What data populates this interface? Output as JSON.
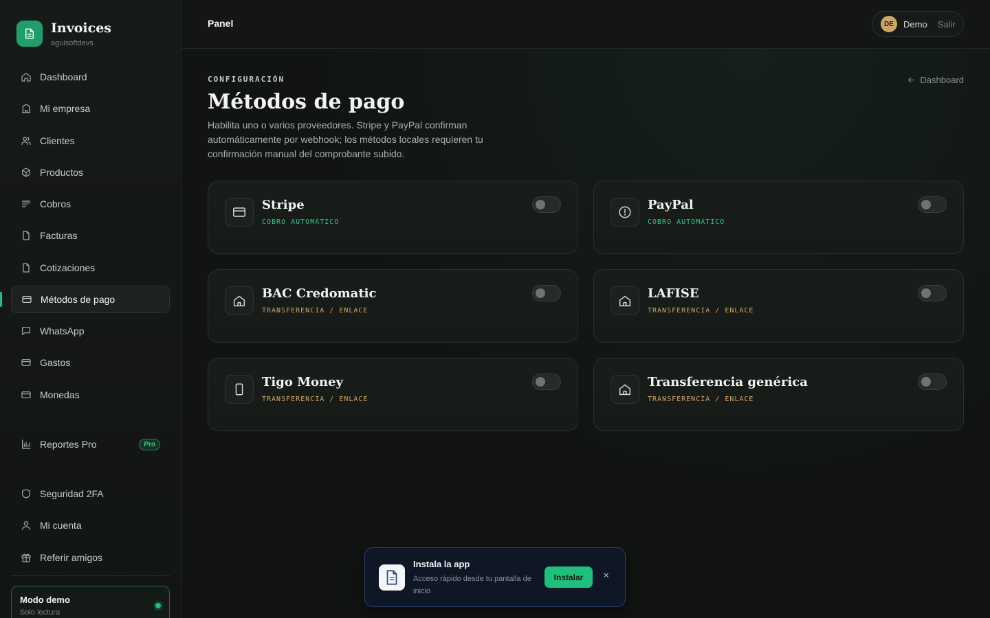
{
  "brand": {
    "title": "Invoices",
    "subtitle": "aguisoftdevs"
  },
  "sidebar": {
    "items": [
      {
        "label": "Dashboard",
        "icon": "home-icon"
      },
      {
        "label": "Mi empresa",
        "icon": "building-icon"
      },
      {
        "label": "Clientes",
        "icon": "users-icon"
      },
      {
        "label": "Productos",
        "icon": "box-icon"
      },
      {
        "label": "Cobros",
        "icon": "lines-icon"
      },
      {
        "label": "Facturas",
        "icon": "file-icon"
      },
      {
        "label": "Cotizaciones",
        "icon": "file-icon"
      },
      {
        "label": "Métodos de pago",
        "icon": "card-icon",
        "active": true
      },
      {
        "label": "WhatsApp",
        "icon": "chat-icon"
      },
      {
        "label": "Gastos",
        "icon": "card-icon"
      },
      {
        "label": "Monedas",
        "icon": "card-icon"
      }
    ],
    "reports": {
      "label": "Reportes Pro",
      "badge": "Pro"
    },
    "bottom_items": [
      {
        "label": "Seguridad 2FA",
        "icon": "shield-icon"
      },
      {
        "label": "Mi cuenta",
        "icon": "user-icon"
      },
      {
        "label": "Referir amigos",
        "icon": "gift-icon"
      }
    ],
    "demo": {
      "title": "Modo demo",
      "subtitle": "Solo lectura"
    }
  },
  "topbar": {
    "title": "Panel",
    "avatar_initials": "DE",
    "user_name": "Demo",
    "logout_label": "Salir"
  },
  "page": {
    "eyebrow": "CONFIGURACIÓN",
    "title": "Métodos de pago",
    "description": "Habilita uno o varios proveedores. Stripe y PayPal confirman automáticamente por webhook; los métodos locales requieren tu confirmación manual del comprobante subido.",
    "back_label": "Dashboard"
  },
  "providers": [
    {
      "name": "Stripe",
      "type": "COBRO AUTOMÁTICO",
      "kind": "auto",
      "icon": "credit-card-icon",
      "enabled": false
    },
    {
      "name": "PayPal",
      "type": "COBRO AUTOMÁTICO",
      "kind": "auto",
      "icon": "paypal-icon",
      "enabled": false
    },
    {
      "name": "BAC Credomatic",
      "type": "TRANSFERENCIA / ENLACE",
      "kind": "manual",
      "icon": "bank-icon",
      "enabled": false
    },
    {
      "name": "LAFISE",
      "type": "TRANSFERENCIA / ENLACE",
      "kind": "manual",
      "icon": "bank-icon",
      "enabled": false
    },
    {
      "name": "Tigo Money",
      "type": "TRANSFERENCIA / ENLACE",
      "kind": "manual",
      "icon": "phone-icon",
      "enabled": false
    },
    {
      "name": "Transferencia genérica",
      "type": "TRANSFERENCIA / ENLACE",
      "kind": "manual",
      "icon": "bank-icon",
      "enabled": false
    }
  ],
  "install_banner": {
    "title": "Instala la app",
    "subtitle": "Acceso rápido desde tu pantalla de inicio",
    "button_label": "Instalar",
    "close_label": "×"
  },
  "colors": {
    "accent": "#1fbf7c",
    "auto": "#2fc98a",
    "manual": "#d3a562",
    "background": "#111412"
  }
}
